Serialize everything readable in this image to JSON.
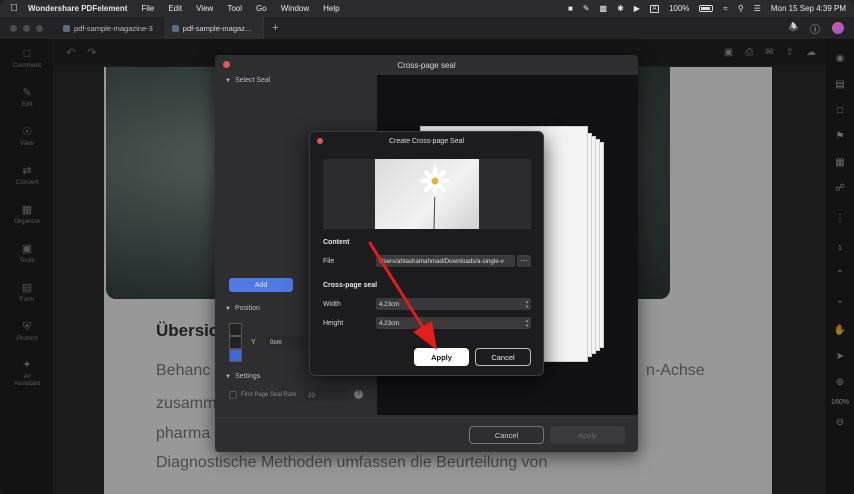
{
  "menubar": {
    "app_name": "Wondershare PDFelement",
    "menus": [
      "File",
      "Edit",
      "View",
      "Tool",
      "Go",
      "Window",
      "Help"
    ],
    "input_source": "A",
    "battery": "100%",
    "datetime": "Mon 15 Sep  4:39 PM"
  },
  "tabs": [
    {
      "label": "pdf-sample-magazine-3"
    },
    {
      "label": "pdf-sample-magaz..."
    }
  ],
  "sidebar": {
    "items": [
      {
        "label": "Comment",
        "icon": "comment-icon"
      },
      {
        "label": "Edit",
        "icon": "edit-icon"
      },
      {
        "label": "View",
        "icon": "eye-icon"
      },
      {
        "label": "Convert",
        "icon": "convert-icon"
      },
      {
        "label": "Organize",
        "icon": "organize-icon"
      },
      {
        "label": "Tools",
        "icon": "toolbox-icon"
      },
      {
        "label": "Form",
        "icon": "form-icon"
      },
      {
        "label": "Protect",
        "icon": "shield-icon"
      },
      {
        "label": "AI\nAssistant",
        "icon": "ai-icon"
      }
    ]
  },
  "document": {
    "heading": "Übersic",
    "lines": [
      "Behanc",
      "zusamm",
      "pharma",
      "Diagnostische Methoden umfassen die Beurteilung von"
    ],
    "right_fragment": "n-Achse"
  },
  "right_panel": {
    "page_number": "1",
    "zoom": "160%"
  },
  "seal_dialog": {
    "title": "Cross-page seal",
    "select_seal": "Select Seal",
    "add_button": "Add",
    "position": "Position",
    "y_label": "Y",
    "y_value": "0cm",
    "settings": "Settings",
    "first_page_seal_rate": "First Page Seal Rate",
    "rate_value": "20",
    "cancel": "Cancel",
    "apply": "Apply"
  },
  "create_dialog": {
    "title": "Create Cross-page Seal",
    "content_label": "Content",
    "file_label": "File",
    "file_path": "Users/ahtashamahmad/Downloads/a-single-v",
    "cross_page_seal_label": "Cross-page seal",
    "width_label": "Width",
    "width_value": "4.23cm",
    "height_label": "Height",
    "height_value": "4.23cm",
    "apply": "Apply",
    "cancel": "Cancel"
  },
  "colors": {
    "accent_blue": "#4f78e3",
    "close_red": "#e0584f",
    "arrow_red": "#e11d1d"
  }
}
